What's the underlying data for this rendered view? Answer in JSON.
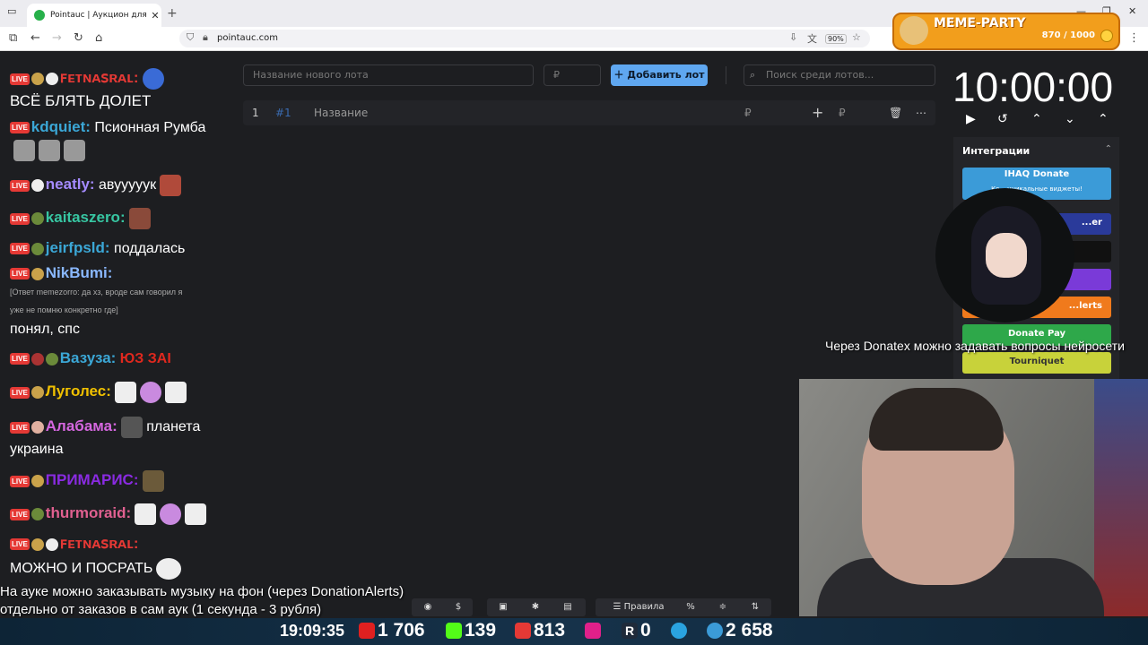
{
  "browser": {
    "tab_title": "Pointauc | Аукцион для стримеров",
    "url": "pointauc.com",
    "zoom": "90%"
  },
  "meme_party": {
    "title": "MEME-PARTY",
    "counter": "870 / 1000"
  },
  "chat": {
    "messages": [
      {
        "nick": "ꜰᴇᴛɴᴀꜱʀᴀʟ:",
        "text": "",
        "nick_color": "#e53935"
      },
      {
        "nick": "",
        "text": "ВСЁ БЛЯТЬ ДОЛЕТ",
        "nick_color": "#ffffff"
      },
      {
        "nick": "kdquiet:",
        "text": "Псионная Румба",
        "nick_color": "#3ba7d6"
      },
      {
        "nick": "neatly:",
        "text": "авууууук",
        "nick_color": "#a58bff"
      },
      {
        "nick": "kaitaszero:",
        "text": "",
        "nick_color": "#37c6a2"
      },
      {
        "nick": "jeirfpsld:",
        "text": "поддалась",
        "nick_color": "#3ba7d6"
      },
      {
        "nick": "NikBumi:",
        "text": "",
        "nick_color": "#8ab8ff"
      },
      {
        "nick": "",
        "text": "понял, спс",
        "nick_color": "#ffffff"
      },
      {
        "nick": "Вазуза:",
        "text": "",
        "nick_color": "#3ba7d6"
      },
      {
        "nick": "Луголес:",
        "text": "",
        "nick_color": "#f0c000"
      },
      {
        "nick": "Алабама:",
        "text": "планета",
        "nick_color": "#d667e0"
      },
      {
        "nick": "",
        "text": "украина",
        "nick_color": "#ffffff"
      },
      {
        "nick": "ПРИМАРИС:",
        "text": "",
        "nick_color": "#8a2be2"
      },
      {
        "nick": "thurmoraid:",
        "text": "",
        "nick_color": "#e06090"
      },
      {
        "nick": "ꜰᴇᴛɴᴀꜱʀᴀʟ:",
        "text": "",
        "nick_color": "#e53935"
      },
      {
        "nick": "",
        "text": "МОЖНО И ПОСРАТЬ",
        "nick_color": "#ffffff"
      }
    ],
    "reply_line1": "[Ответ memezorro: да хз, вроде сам говорил я",
    "reply_line2": "уже не помню конкретно где]",
    "vazuza_emote": "ЮЗ ЗАI",
    "live_label": "LIVE"
  },
  "auction": {
    "lot_name_placeholder": "Название нового лота",
    "price_placeholder": "₽",
    "add_lot_label": "Добавить лот",
    "search_placeholder": "Поиск среди лотов...",
    "row": {
      "index": "1",
      "id": "#1",
      "name": "Название",
      "currency": "₽",
      "amount_currency": "₽"
    }
  },
  "timer": {
    "value": "10:00:00"
  },
  "integrations": {
    "title": "Интеграции",
    "buttons": [
      {
        "label": "IHAQ Donate",
        "sub": "Ко... уникальные виджеты!"
      },
      {
        "label": "...er",
        "sub": ""
      },
      {
        "label": "",
        "sub": ""
      },
      {
        "label": "",
        "sub": ""
      },
      {
        "label": "...lerts",
        "sub": ""
      },
      {
        "label": "Donate Pay",
        "sub": ""
      },
      {
        "label": "Tourniquet",
        "sub": ""
      }
    ]
  },
  "overlay_text": "Через Donatex можно задавать вопросы нейросети",
  "notes": {
    "line1": "На ауке можно заказывать музыку на фон (через DonationAlerts)",
    "line2": "отдельно от заказов в сам аук (1 секунда - 3 рубля)"
  },
  "bottom_toolbar": {
    "rules_label": "Правила"
  },
  "status": {
    "clock": "19:09:35",
    "youtube": "1 706",
    "kick": "139",
    "vklive": "813",
    "other": "0",
    "telegram_viewers": "2 658"
  }
}
